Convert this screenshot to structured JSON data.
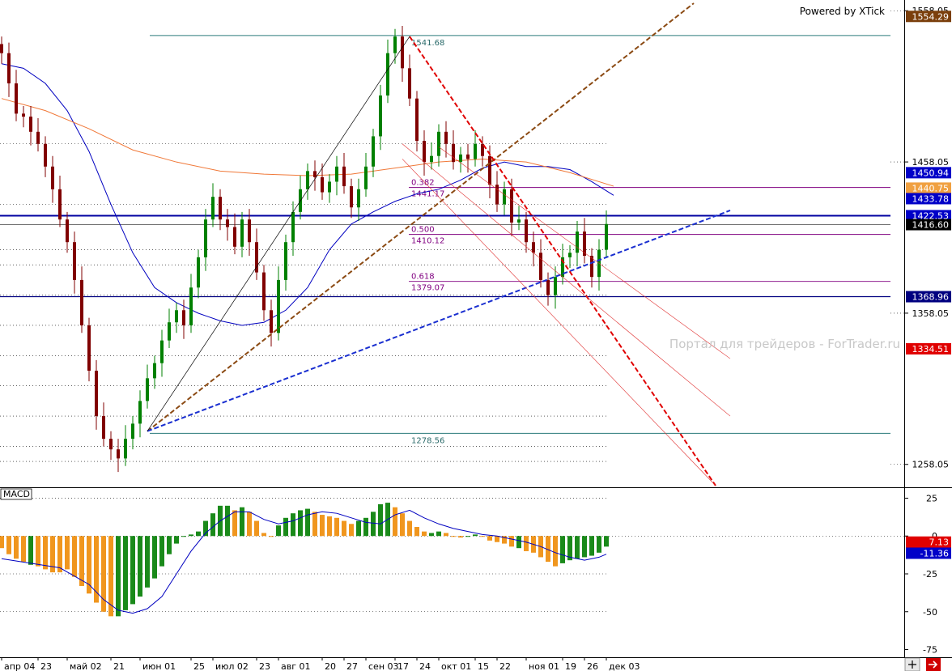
{
  "header": {
    "powered_by": "Powered by XTick"
  },
  "watermark": "Портал для трейдеров - ForTrader.ru",
  "chart_data": [
    {
      "type": "candlestick",
      "panel": "price",
      "ylim": [
        1244,
        1563
      ],
      "x_range": [
        0,
        100
      ],
      "y_ticks": [
        1558.05,
        1458.05,
        1358.05,
        1258.05
      ],
      "x_ticks": [
        {
          "x": 0,
          "label": "апр 04"
        },
        {
          "x": 5,
          "label": "23"
        },
        {
          "x": 9,
          "label": "май 02"
        },
        {
          "x": 15,
          "label": "21"
        },
        {
          "x": 19,
          "label": "июн 01"
        },
        {
          "x": 26,
          "label": "25"
        },
        {
          "x": 29,
          "label": "июл 02"
        },
        {
          "x": 35,
          "label": "23"
        },
        {
          "x": 38,
          "label": "авг 01"
        },
        {
          "x": 44,
          "label": "20"
        },
        {
          "x": 47,
          "label": "27"
        },
        {
          "x": 50,
          "label": "сен 03"
        },
        {
          "x": 54,
          "label": "17"
        },
        {
          "x": 57,
          "label": "24"
        },
        {
          "x": 60,
          "label": "окт 01"
        },
        {
          "x": 65,
          "label": "15"
        },
        {
          "x": 68,
          "label": "22"
        },
        {
          "x": 72,
          "label": "ноя 01"
        },
        {
          "x": 77,
          "label": "19"
        },
        {
          "x": 80,
          "label": "26"
        },
        {
          "x": 83,
          "label": "дек 03"
        }
      ],
      "price_tags": [
        {
          "value": "1554.29",
          "bg": "#7b3f0c",
          "fg": "#ffffff"
        },
        {
          "value": "1450.94",
          "bg": "#0000c8",
          "fg": "#ffffff"
        },
        {
          "value": "1440.75",
          "bg": "#f0a040",
          "fg": "#ffffff"
        },
        {
          "value": "1433.78",
          "bg": "#0000c8",
          "fg": "#ffffff"
        },
        {
          "value": "1422.53",
          "bg": "#0000c8",
          "fg": "#ffffff"
        },
        {
          "value": "1416.60",
          "bg": "#000000",
          "fg": "#ffffff"
        },
        {
          "value": "1368.96",
          "bg": "#000080",
          "fg": "#ffffff"
        },
        {
          "value": "1334.51",
          "bg": "#e00000",
          "fg": "#ffffff"
        }
      ],
      "fibonacci": {
        "high": {
          "value": 1541.68,
          "label": "1541.68"
        },
        "low": {
          "value": 1278.56,
          "label": "1278.56"
        },
        "levels": [
          {
            "ratio": "0.382",
            "value": 1441.17,
            "label": "1441.17"
          },
          {
            "ratio": "0.500",
            "value": 1410.12,
            "label": "1410.12"
          },
          {
            "ratio": "0.618",
            "value": 1379.07,
            "label": "1379.07"
          }
        ]
      },
      "horizontal_lines": [
        {
          "value": 1422.53,
          "color": "#0000a0",
          "width": 2
        },
        {
          "value": 1368.96,
          "color": "#000080",
          "width": 1.2
        },
        {
          "value": 1416.6,
          "color": "#404040",
          "width": 0.8
        }
      ],
      "trend_lines": [
        {
          "p1": [
            20,
            1280
          ],
          "p2": [
            95,
            1563
          ],
          "color": "#8b4a13",
          "style": "dashed",
          "width": 2
        },
        {
          "p1": [
            20,
            1280
          ],
          "p2": [
            100,
            1426
          ],
          "color": "#1a2fd0",
          "style": "dashed",
          "width": 2
        },
        {
          "p1": [
            56,
            1541
          ],
          "p2": [
            98,
            1244
          ],
          "color": "#e00000",
          "style": "dashed",
          "width": 2
        },
        {
          "p1": [
            20,
            1280
          ],
          "p2": [
            56,
            1541
          ],
          "color": "#000000",
          "style": "solid",
          "width": 0.7
        },
        {
          "p1": [
            60,
            1468
          ],
          "p2": [
            100,
            1328
          ],
          "color": "#e03030",
          "style": "solid",
          "width": 0.6
        },
        {
          "p1": [
            55,
            1460
          ],
          "p2": [
            98,
            1244
          ],
          "color": "#e03030",
          "style": "solid",
          "width": 0.6
        },
        {
          "p1": [
            55,
            1470
          ],
          "p2": [
            100,
            1290
          ],
          "color": "#e03030",
          "style": "solid",
          "width": 0.6
        }
      ],
      "series": [
        {
          "name": "",
          "kind": "ma",
          "color": "#0000c0",
          "x": [
            0,
            3,
            6,
            9,
            12,
            15,
            18,
            21,
            24,
            27,
            30,
            33,
            36,
            39,
            42,
            45,
            48,
            51,
            54,
            57,
            60,
            63,
            66,
            69,
            72,
            75,
            78,
            81,
            84
          ],
          "values": [
            1523,
            1520,
            1510,
            1492,
            1465,
            1430,
            1398,
            1375,
            1365,
            1358,
            1353,
            1350,
            1352,
            1360,
            1375,
            1400,
            1417,
            1425,
            1432,
            1437,
            1440,
            1446,
            1454,
            1458,
            1455,
            1455,
            1453,
            1445,
            1436
          ]
        },
        {
          "name": "",
          "kind": "ma",
          "color": "#f07838",
          "x": [
            0,
            6,
            12,
            18,
            24,
            30,
            36,
            42,
            48,
            54,
            60,
            66,
            72,
            78,
            84
          ],
          "values": [
            1500,
            1492,
            1480,
            1466,
            1458,
            1452,
            1450,
            1449,
            1450,
            1454,
            1458,
            1460,
            1458,
            1451,
            1442
          ]
        },
        {
          "name": "",
          "kind": "candles",
          "color_up": "#008000",
          "color_down": "#800000",
          "x": [
            0,
            1,
            2,
            3,
            4,
            5,
            6,
            7,
            8,
            9,
            10,
            11,
            12,
            13,
            14,
            15,
            16,
            17,
            18,
            19,
            20,
            21,
            22,
            23,
            24,
            25,
            26,
            27,
            28,
            29,
            30,
            31,
            32,
            33,
            34,
            35,
            36,
            37,
            38,
            39,
            40,
            41,
            42,
            43,
            44,
            45,
            46,
            47,
            48,
            49,
            50,
            51,
            52,
            53,
            54,
            55,
            56,
            57,
            58,
            59,
            60,
            61,
            62,
            63,
            64,
            65,
            66,
            67,
            68,
            69,
            70,
            71,
            72,
            73,
            74,
            75,
            76,
            77,
            78,
            79,
            80,
            81,
            82,
            83
          ],
          "close": [
            1530,
            1510,
            1490,
            1488,
            1478,
            1470,
            1455,
            1440,
            1420,
            1405,
            1380,
            1350,
            1320,
            1290,
            1275,
            1268,
            1262,
            1275,
            1285,
            1300,
            1315,
            1325,
            1340,
            1352,
            1360,
            1350,
            1375,
            1395,
            1420,
            1435,
            1420,
            1415,
            1402,
            1420,
            1405,
            1385,
            1360,
            1345,
            1380,
            1405,
            1425,
            1440,
            1452,
            1448,
            1438,
            1445,
            1455,
            1442,
            1428,
            1440,
            1455,
            1475,
            1502,
            1530,
            1541,
            1520,
            1500,
            1472,
            1458,
            1462,
            1478,
            1470,
            1458,
            1463,
            1460,
            1470,
            1462,
            1443,
            1430,
            1440,
            1418,
            1420,
            1405,
            1398,
            1380,
            1370,
            1382,
            1395,
            1398,
            1412,
            1396,
            1382,
            1400,
            1417
          ]
        }
      ]
    },
    {
      "type": "histogram",
      "panel": "macd",
      "title": "MACD",
      "ylim": [
        -79,
        29
      ],
      "y_ticks": [
        25,
        0,
        -25,
        -50,
        -75
      ],
      "tags": [
        {
          "value": "7.13",
          "bg": "#e00000",
          "fg": "#ffffff"
        },
        {
          "value": "-11.36",
          "bg": "#0000c8",
          "fg": "#ffffff"
        }
      ],
      "x": [
        0,
        1,
        2,
        3,
        4,
        5,
        6,
        7,
        8,
        9,
        10,
        11,
        12,
        13,
        14,
        15,
        16,
        17,
        18,
        19,
        20,
        21,
        22,
        23,
        24,
        25,
        26,
        27,
        28,
        29,
        30,
        31,
        32,
        33,
        34,
        35,
        36,
        37,
        38,
        39,
        40,
        41,
        42,
        43,
        44,
        45,
        46,
        47,
        48,
        49,
        50,
        51,
        52,
        53,
        54,
        55,
        56,
        57,
        58,
        59,
        60,
        61,
        62,
        63,
        64,
        65,
        66,
        67,
        68,
        69,
        70,
        71,
        72,
        73,
        74,
        75,
        76,
        77,
        78,
        79,
        80,
        81,
        82,
        83
      ],
      "values": [
        -8,
        -12,
        -15,
        -17,
        -19,
        -20,
        -22,
        -24,
        -24,
        -22,
        -27,
        -33,
        -38,
        -44,
        -50,
        -53,
        -53,
        -49,
        -45,
        -40,
        -34,
        -28,
        -20,
        -12,
        -5,
        0,
        1,
        3,
        10,
        15,
        20,
        20,
        17,
        19,
        16,
        10,
        2,
        0,
        7,
        12,
        15,
        17,
        18,
        16,
        14,
        13,
        12,
        10,
        8,
        10,
        12,
        16,
        21,
        22,
        19,
        15,
        10,
        6,
        3,
        2,
        3,
        2,
        0,
        -1,
        0,
        1,
        0,
        -3,
        -4,
        -5,
        -7,
        -8,
        -10,
        -11,
        -14,
        -17,
        -20,
        -18,
        -16,
        -15,
        -14,
        -13,
        -11,
        -7
      ],
      "colors": [
        "o",
        "o",
        "o",
        "o",
        "g",
        "o",
        "o",
        "o",
        "o",
        "o",
        "o",
        "o",
        "o",
        "o",
        "o",
        "o",
        "g",
        "g",
        "g",
        "g",
        "g",
        "g",
        "g",
        "g",
        "g",
        "g",
        "g",
        "g",
        "g",
        "g",
        "g",
        "g",
        "o",
        "g",
        "o",
        "o",
        "o",
        "o",
        "g",
        "g",
        "g",
        "g",
        "g",
        "o",
        "o",
        "o",
        "o",
        "o",
        "o",
        "g",
        "g",
        "g",
        "g",
        "g",
        "o",
        "o",
        "o",
        "o",
        "o",
        "g",
        "g",
        "o",
        "o",
        "o",
        "g",
        "g",
        "o",
        "o",
        "o",
        "o",
        "o",
        "g",
        "o",
        "o",
        "o",
        "o",
        "o",
        "g",
        "g",
        "g",
        "g",
        "g",
        "g",
        "g"
      ],
      "series": [
        {
          "name": "",
          "color": "#0000c0",
          "x": [
            0,
            4,
            8,
            12,
            14,
            16,
            18,
            20,
            22,
            24,
            26,
            28,
            30,
            32,
            34,
            36,
            38,
            40,
            42,
            44,
            46,
            48,
            50,
            52,
            54,
            56,
            58,
            60,
            62,
            64,
            66,
            68,
            70,
            72,
            74,
            76,
            78,
            80,
            82,
            83
          ],
          "values": [
            -15,
            -18,
            -21,
            -32,
            -42,
            -49,
            -51,
            -48,
            -40,
            -25,
            -10,
            2,
            10,
            16,
            16,
            11,
            8,
            10,
            14,
            16,
            15,
            12,
            9,
            8,
            14,
            17,
            12,
            8,
            5,
            3,
            1,
            0,
            -2,
            -4,
            -7,
            -11,
            -14,
            -16,
            -14,
            -12
          ]
        }
      ]
    }
  ]
}
